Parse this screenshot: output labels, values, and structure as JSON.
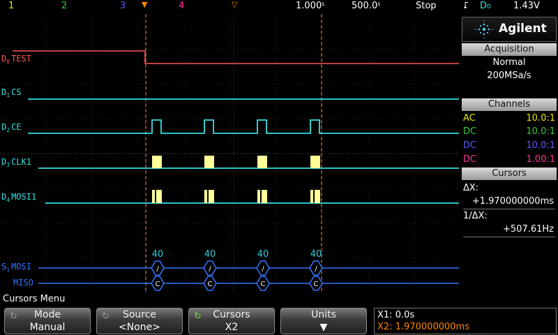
{
  "topbar": {
    "ch1": "1",
    "ch2": "2",
    "ch3": "3",
    "ch4": "4",
    "timescale": "1.000",
    "timescale_unit": "s",
    "timescale_prefix": "s",
    "samplerate": "500.0",
    "samplerate_unit": "s",
    "samplerate_prefix": "s",
    "run_state": "Stop",
    "trigger_source": "D",
    "trigger_source_sub": "0",
    "trigger_level": "1.43V",
    "colors": {
      "ch1": "#e8e800",
      "ch2": "#33cc33",
      "ch3": "#5a5aff",
      "ch4": "#ff3399"
    }
  },
  "waveform": {
    "channels": [
      {
        "id": "D",
        "sub": "0",
        "name": "TEST",
        "color": "#ff5555"
      },
      {
        "id": "D",
        "sub": "1",
        "name": "CS",
        "color": "#33e0e0"
      },
      {
        "id": "D",
        "sub": "2",
        "name": "CE",
        "color": "#33e0e0"
      },
      {
        "id": "D",
        "sub": "3",
        "name": "CLK1",
        "color": "#33e0e0"
      },
      {
        "id": "D",
        "sub": "4",
        "name": "MOSI1",
        "color": "#33e0e0"
      }
    ],
    "serial": {
      "id": "S",
      "sub": "1",
      "mosi_label": "MOSI",
      "miso_label": "MISO",
      "packet_count_label": "40",
      "mosi_symbol": "/",
      "miso_symbol": "C",
      "color": "#3377ff"
    }
  },
  "sidepanel": {
    "brand": "Agilent",
    "acquisition": {
      "title": "Acquisition",
      "mode": "Normal",
      "rate": "200MSa/s"
    },
    "channels": {
      "title": "Channels",
      "rows": [
        {
          "coupling": "AC",
          "probe": "10.0:1",
          "color": "#e8e800"
        },
        {
          "coupling": "DC",
          "probe": "10.0:1",
          "color": "#33cc33"
        },
        {
          "coupling": "DC",
          "probe": "10.0:1",
          "color": "#5a5aff"
        },
        {
          "coupling": "DC",
          "probe": "1.00:1",
          "color": "#ff3399"
        }
      ]
    },
    "cursors": {
      "title": "Cursors",
      "dx_label": "ΔX:",
      "dx_value": "+1.970000000ms",
      "inv_dx_label": "1/ΔX:",
      "inv_dx_value": "+507.61Hz"
    }
  },
  "softkeys": {
    "menu_title": "Cursors Menu",
    "mode": {
      "label": "Mode",
      "value": "Manual"
    },
    "source": {
      "label": "Source",
      "value": "<None>"
    },
    "cursors": {
      "label": "Cursors",
      "value": "X2"
    },
    "units": {
      "label": "Units",
      "value": "▼"
    },
    "readout": {
      "x1": "X1: 0.0s",
      "x2": "X2: 1.970000000ms",
      "x2_color": "#ff8800"
    }
  }
}
